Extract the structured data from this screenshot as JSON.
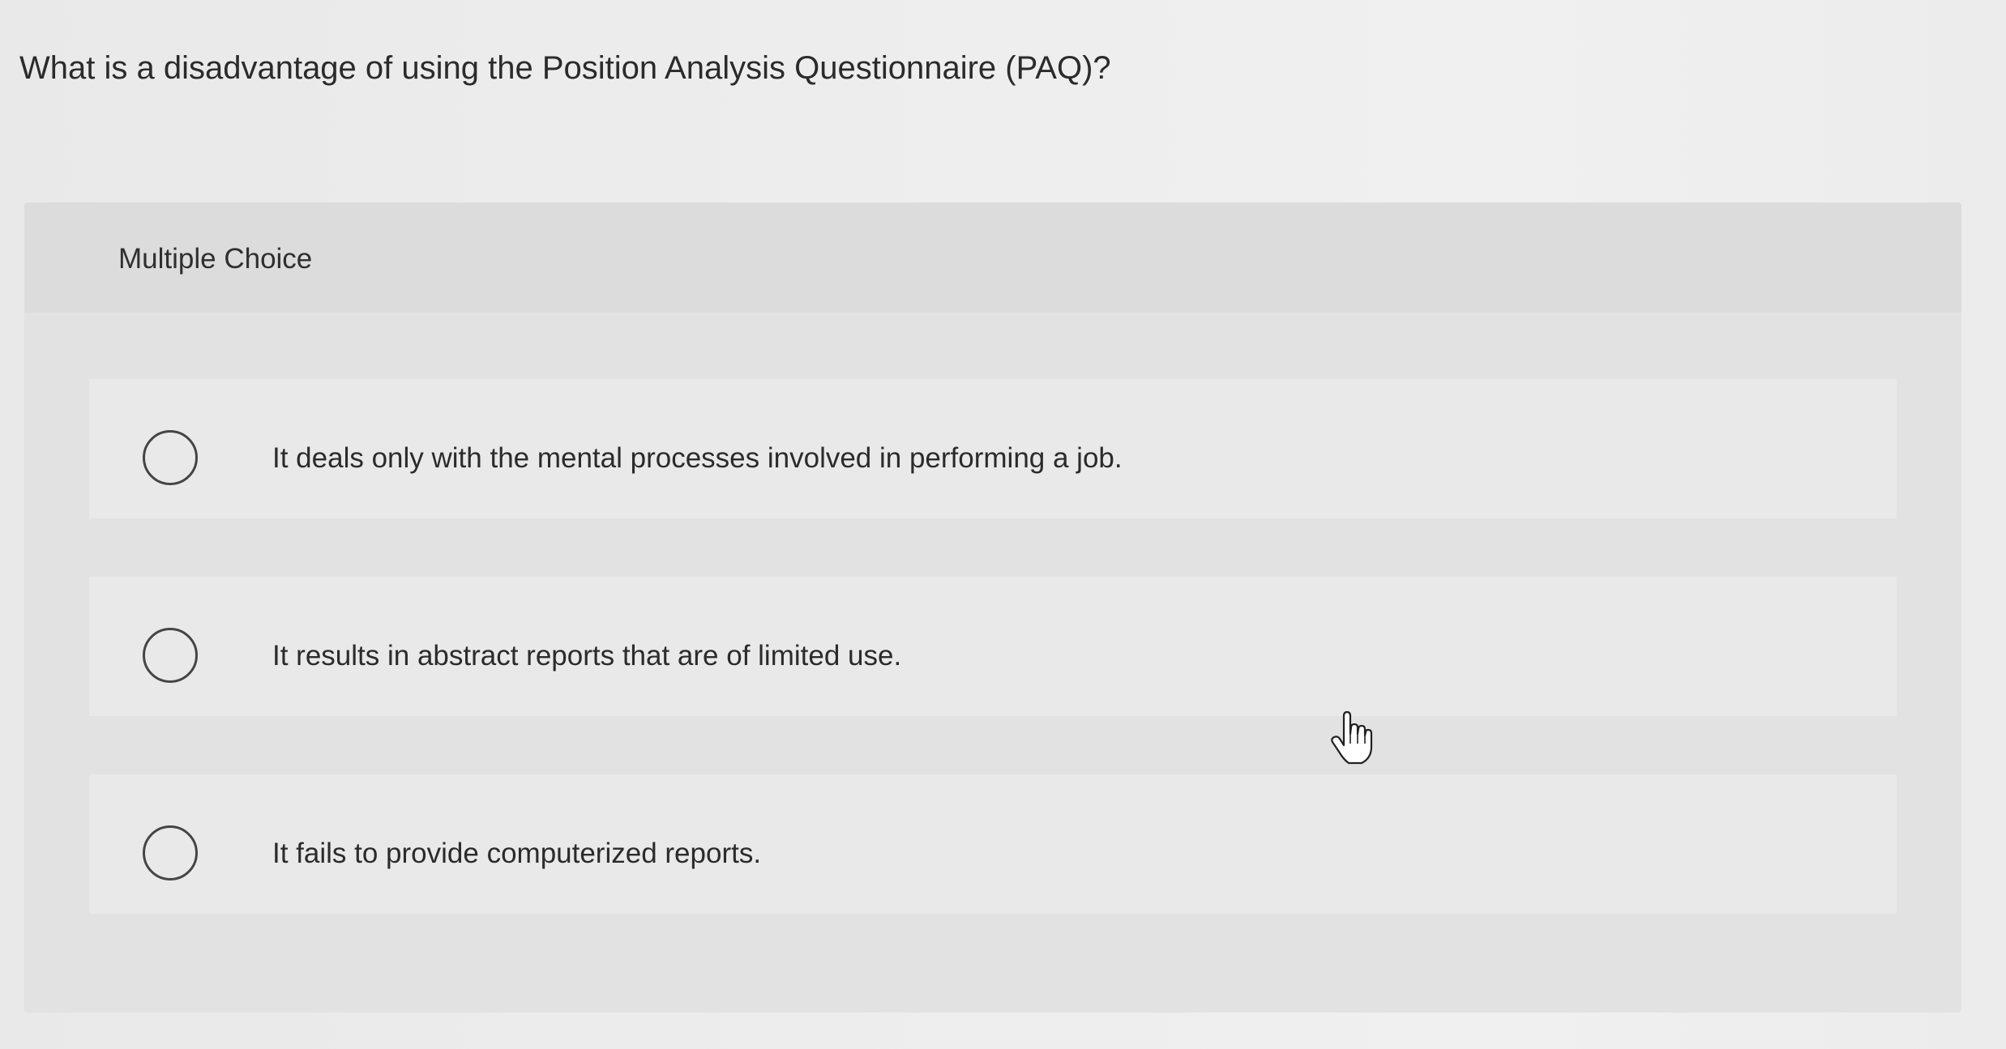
{
  "question": {
    "text": "What is a disadvantage of using the Position Analysis Questionnaire (PAQ)?"
  },
  "panel": {
    "title": "Multiple Choice",
    "options": [
      {
        "label": "It deals only with the mental processes involved in performing a job.",
        "selected": false
      },
      {
        "label": "It results in abstract reports that are of limited use.",
        "selected": false
      },
      {
        "label": "It fails to provide computerized reports.",
        "selected": false
      }
    ]
  },
  "icons": {
    "option_indicator": "radio-circle",
    "mouse_cursor": "hand-pointer-icon"
  }
}
